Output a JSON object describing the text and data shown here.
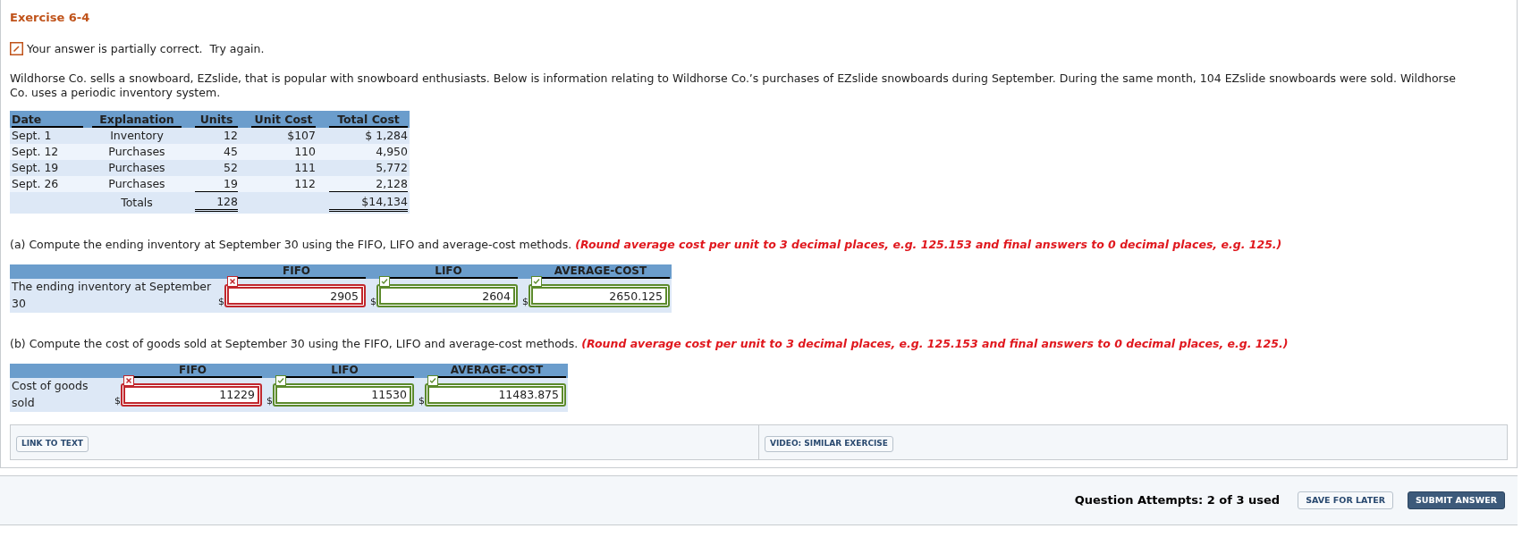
{
  "title": "Exercise 6-4",
  "feedback": "Your answer is partially correct.  Try again.",
  "intro": "Wildhorse Co. sells a snowboard, EZslide, that is popular with snowboard enthusiasts. Below is information relating to Wildhorse Co.’s purchases of EZslide snowboards during September. During the same month, 104 EZslide snowboards were sold. Wildhorse Co. uses a periodic inventory system.",
  "purchases_table": {
    "columns": [
      "Date",
      "Explanation",
      "Units",
      "Unit Cost",
      "Total Cost"
    ],
    "rows": [
      {
        "date": "Sept. 1",
        "explanation": "Inventory",
        "units": "12",
        "unit_cost": "$107",
        "total_cost": "$ 1,284"
      },
      {
        "date": "Sept. 12",
        "explanation": "Purchases",
        "units": "45",
        "unit_cost": "110",
        "total_cost": "4,950"
      },
      {
        "date": "Sept. 19",
        "explanation": "Purchases",
        "units": "52",
        "unit_cost": "111",
        "total_cost": "5,772"
      },
      {
        "date": "Sept. 26",
        "explanation": "Purchases",
        "units": "19",
        "unit_cost": "112",
        "total_cost": "2,128"
      }
    ],
    "totals": {
      "label": "Totals",
      "units": "128",
      "total_cost": "$14,134"
    }
  },
  "parts": [
    {
      "prompt": "(a) Compute the ending inventory at September 30 using the FIFO, LIFO and average-cost methods.",
      "note": "(Round average cost per unit to 3 decimal places, e.g. 125.153 and final answers to 0 decimal places, e.g. 125.)",
      "columns": [
        "FIFO",
        "LIFO",
        "AVERAGE-COST"
      ],
      "row_label": "The ending inventory at September 30",
      "answers": [
        {
          "currency": "$",
          "value": "2905",
          "correct": false
        },
        {
          "currency": "$",
          "value": "2604",
          "correct": true
        },
        {
          "currency": "$",
          "value": "2650.125",
          "correct": true
        }
      ]
    },
    {
      "prompt": "(b) Compute the cost of goods sold at September 30 using the FIFO, LIFO and average-cost methods.",
      "note": "(Round average cost per unit to 3 decimal places, e.g. 125.153 and final answers to 0 decimal places, e.g. 125.)",
      "columns": [
        "FIFO",
        "LIFO",
        "AVERAGE-COST"
      ],
      "row_label": "Cost of goods sold",
      "answers": [
        {
          "currency": "$",
          "value": "11229",
          "correct": false
        },
        {
          "currency": "$",
          "value": "11530",
          "correct": true
        },
        {
          "currency": "$",
          "value": "11483.875",
          "correct": true
        }
      ]
    }
  ],
  "links": [
    "LINK TO TEXT",
    "VIDEO: SIMILAR EXERCISE"
  ],
  "attempts": "Question Attempts: 2 of 3 used",
  "buttons": [
    {
      "label": "SAVE FOR LATER",
      "kind": "secondary"
    },
    {
      "label": "SUBMIT ANSWER",
      "kind": "primary"
    }
  ]
}
